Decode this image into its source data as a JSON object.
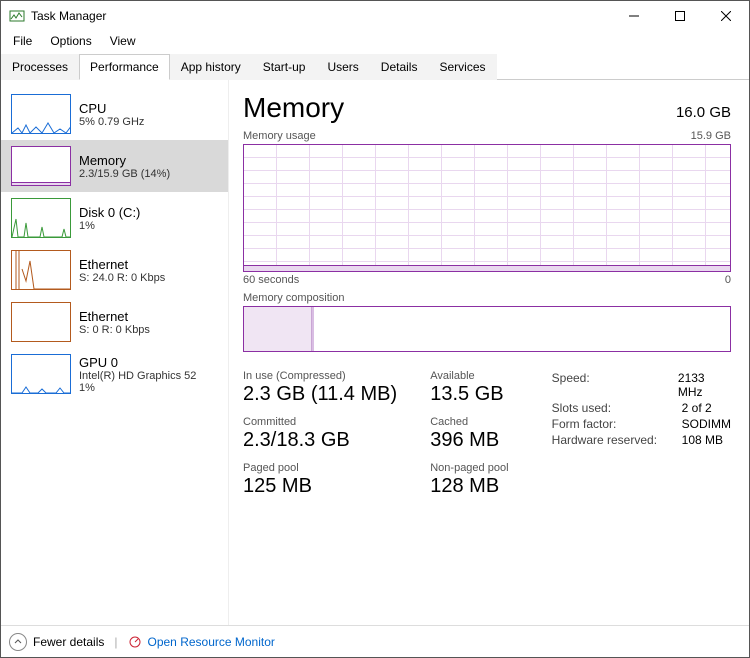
{
  "window": {
    "title": "Task Manager"
  },
  "menu": {
    "file": "File",
    "options": "Options",
    "view": "View"
  },
  "tabs": {
    "processes": "Processes",
    "performance": "Performance",
    "app_history": "App history",
    "startup": "Start-up",
    "users": "Users",
    "details": "Details",
    "services": "Services"
  },
  "sidebar": {
    "cpu": {
      "name": "CPU",
      "sub": "5%  0.79 GHz"
    },
    "memory": {
      "name": "Memory",
      "sub": "2.3/15.9 GB (14%)"
    },
    "disk": {
      "name": "Disk 0 (C:)",
      "sub": "1%"
    },
    "eth0": {
      "name": "Ethernet",
      "sub": "S: 24.0  R: 0 Kbps"
    },
    "eth1": {
      "name": "Ethernet",
      "sub": "S: 0  R: 0 Kbps"
    },
    "gpu": {
      "name": "GPU 0",
      "sub1": "Intel(R) HD Graphics 52",
      "sub2": "1%"
    }
  },
  "main": {
    "title": "Memory",
    "total": "16.0 GB",
    "usage_label": "Memory usage",
    "usage_max": "15.9 GB",
    "axis_left": "60 seconds",
    "axis_right": "0",
    "comp_label": "Memory composition",
    "in_use_label": "In use (Compressed)",
    "in_use_value": "2.3 GB (11.4 MB)",
    "available_label": "Available",
    "available_value": "13.5 GB",
    "committed_label": "Committed",
    "committed_value": "2.3/18.3 GB",
    "cached_label": "Cached",
    "cached_value": "396 MB",
    "paged_label": "Paged pool",
    "paged_value": "125 MB",
    "nonpaged_label": "Non-paged pool",
    "nonpaged_value": "128 MB",
    "hw": {
      "speed_k": "Speed:",
      "speed_v": "2133 MHz",
      "slots_k": "Slots used:",
      "slots_v": "2 of 2",
      "form_k": "Form factor:",
      "form_v": "SODIMM",
      "reserved_k": "Hardware reserved:",
      "reserved_v": "108 MB"
    }
  },
  "footer": {
    "fewer": "Fewer details",
    "open_rm": "Open Resource Monitor"
  },
  "chart_data": {
    "type": "line",
    "title": "Memory usage",
    "xlabel": "seconds ago",
    "ylabel": "GB",
    "ylim": [
      0,
      15.9
    ],
    "x": [
      60,
      55,
      50,
      45,
      40,
      35,
      30,
      25,
      20,
      15,
      10,
      5,
      0
    ],
    "values": [
      2.3,
      2.3,
      2.3,
      2.3,
      2.3,
      2.3,
      2.3,
      2.3,
      2.3,
      2.3,
      2.3,
      2.3,
      2.3
    ],
    "composition": {
      "in_use_gb": 2.3,
      "modified_gb": 0.1,
      "standby_gb": 0.4,
      "free_gb": 13.1
    }
  }
}
